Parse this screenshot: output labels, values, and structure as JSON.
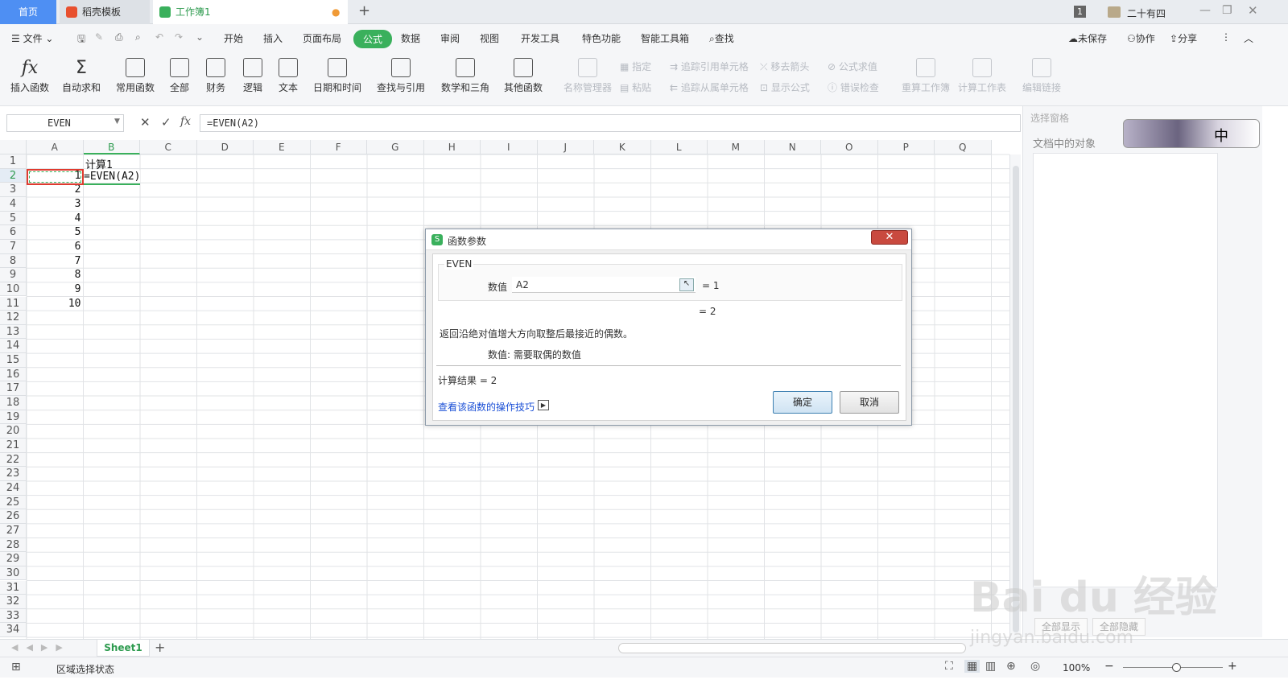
{
  "tabs": {
    "home": "首页",
    "daoke": "稻壳模板",
    "workbook": "工作簿1"
  },
  "user": {
    "badge": "1",
    "name": "二十有四"
  },
  "menu": {
    "file": "文件",
    "items": [
      "开始",
      "插入",
      "页面布局",
      "公式",
      "数据",
      "审阅",
      "视图",
      "开发工具",
      "特色功能",
      "智能工具箱"
    ],
    "search": "查找",
    "unsaved": "未保存",
    "collab": "协作",
    "share": "分享"
  },
  "ribbon": {
    "insert_fn": "插入函数",
    "autosum": "自动求和",
    "common": "常用函数",
    "all": "全部",
    "finance": "财务",
    "logic": "逻辑",
    "text": "文本",
    "datetime": "日期和时间",
    "lookup": "查找与引用",
    "math": "数学和三角",
    "other": "其他函数",
    "name_mgr": "名称管理器",
    "specify": "指定",
    "paste": "粘贴",
    "trace_prec": "追踪引用单元格",
    "trace_dep": "追踪从属单元格",
    "remove_arrows": "移去箭头",
    "show_formula": "显示公式",
    "eval_formula": "公式求值",
    "error_check": "错误检查",
    "recalc_book": "重算工作簿",
    "calc_sheet": "计算工作表",
    "edit_links": "编辑链接"
  },
  "formula_bar": {
    "namebox": "EVEN",
    "formula": "=EVEN(A2)"
  },
  "grid": {
    "columns": [
      "A",
      "B",
      "C",
      "D",
      "E",
      "F",
      "G",
      "H",
      "I",
      "J",
      "K",
      "L",
      "M",
      "N",
      "O",
      "P",
      "Q"
    ],
    "rows": [
      "1",
      "2",
      "3",
      "4",
      "5",
      "6",
      "7",
      "8",
      "9",
      "10",
      "11",
      "12",
      "13",
      "14",
      "15",
      "16",
      "17",
      "18",
      "19",
      "20",
      "21",
      "22",
      "23",
      "24",
      "25",
      "26",
      "27",
      "28",
      "29",
      "30",
      "31",
      "32",
      "33",
      "34"
    ],
    "b1": "计算1",
    "b2": "=EVEN(A2)",
    "a_values": [
      "1",
      "2",
      "3",
      "4",
      "5",
      "6",
      "7",
      "8",
      "9",
      "10"
    ]
  },
  "right_pane": {
    "title": "选择窗格",
    "objects": "文档中的对象",
    "show_all": "全部显示",
    "hide_all": "全部隐藏",
    "ime": "中"
  },
  "sheet": {
    "name": "Sheet1"
  },
  "status": {
    "mode": "区域选择状态",
    "zoom": "100%"
  },
  "dialog": {
    "title": "函数参数",
    "fn": "EVEN",
    "arg_label": "数值",
    "arg_value": "A2",
    "arg_result": "= 1",
    "fn_result": "= 2",
    "desc": "返回沿绝对值增大方向取整后最接近的偶数。",
    "arg_desc": "数值:  需要取偶的数值",
    "calc_result": "计算结果 = 2",
    "help_link": "查看该函数的操作技巧",
    "ok": "确定",
    "cancel": "取消"
  },
  "watermark": {
    "brand": "Bai du 经验",
    "url": "jingyan.baidu.com"
  },
  "colors": {
    "accent": "#3ab05c",
    "home_tab": "#4e8ff3",
    "selection": "#e03b2f",
    "link": "#1a4fd6"
  }
}
